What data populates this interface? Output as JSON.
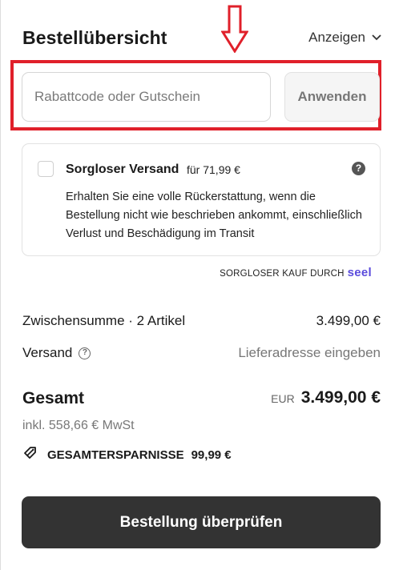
{
  "header": {
    "title": "Bestellübersicht",
    "toggle_label": "Anzeigen",
    "toggle_icon": "chevron-down-icon"
  },
  "discount": {
    "placeholder": "Rabattcode oder Gutschein",
    "value": "",
    "apply_label": "Anwenden"
  },
  "annotation": {
    "arrow_color": "#e0202a",
    "box_color": "#e0202a"
  },
  "protection": {
    "title": "Sorgloser Versand",
    "price": "für 71,99 €",
    "help_icon": "question-circle-icon",
    "help_glyph": "?",
    "description": "Erhalten Sie eine volle Rückerstattung, wenn die Bestellung nicht wie beschrieben ankommt, einschließlich Verlust und Beschädigung im Transit",
    "checked": false
  },
  "seel": {
    "text": "SORGLOSER KAUF DURCH",
    "logo": "seel",
    "logo_color": "#5a4bdc"
  },
  "summary": {
    "subtotal_label": "Zwischensumme · 2 Artikel",
    "subtotal_value": "3.499,00 €",
    "shipping_label": "Versand",
    "shipping_help_glyph": "?",
    "shipping_value": "Lieferadresse eingeben",
    "total_label": "Gesamt",
    "currency": "EUR",
    "total_value": "3.499,00 €",
    "tax_note": "inkl. 558,66 € MwSt",
    "savings_label": "GESAMTERSPARNISSE",
    "savings_value": "99,99 €",
    "savings_icon": "price-tag-icon"
  },
  "actions": {
    "review_label": "Bestellung überprüfen",
    "button_color": "#333333"
  }
}
